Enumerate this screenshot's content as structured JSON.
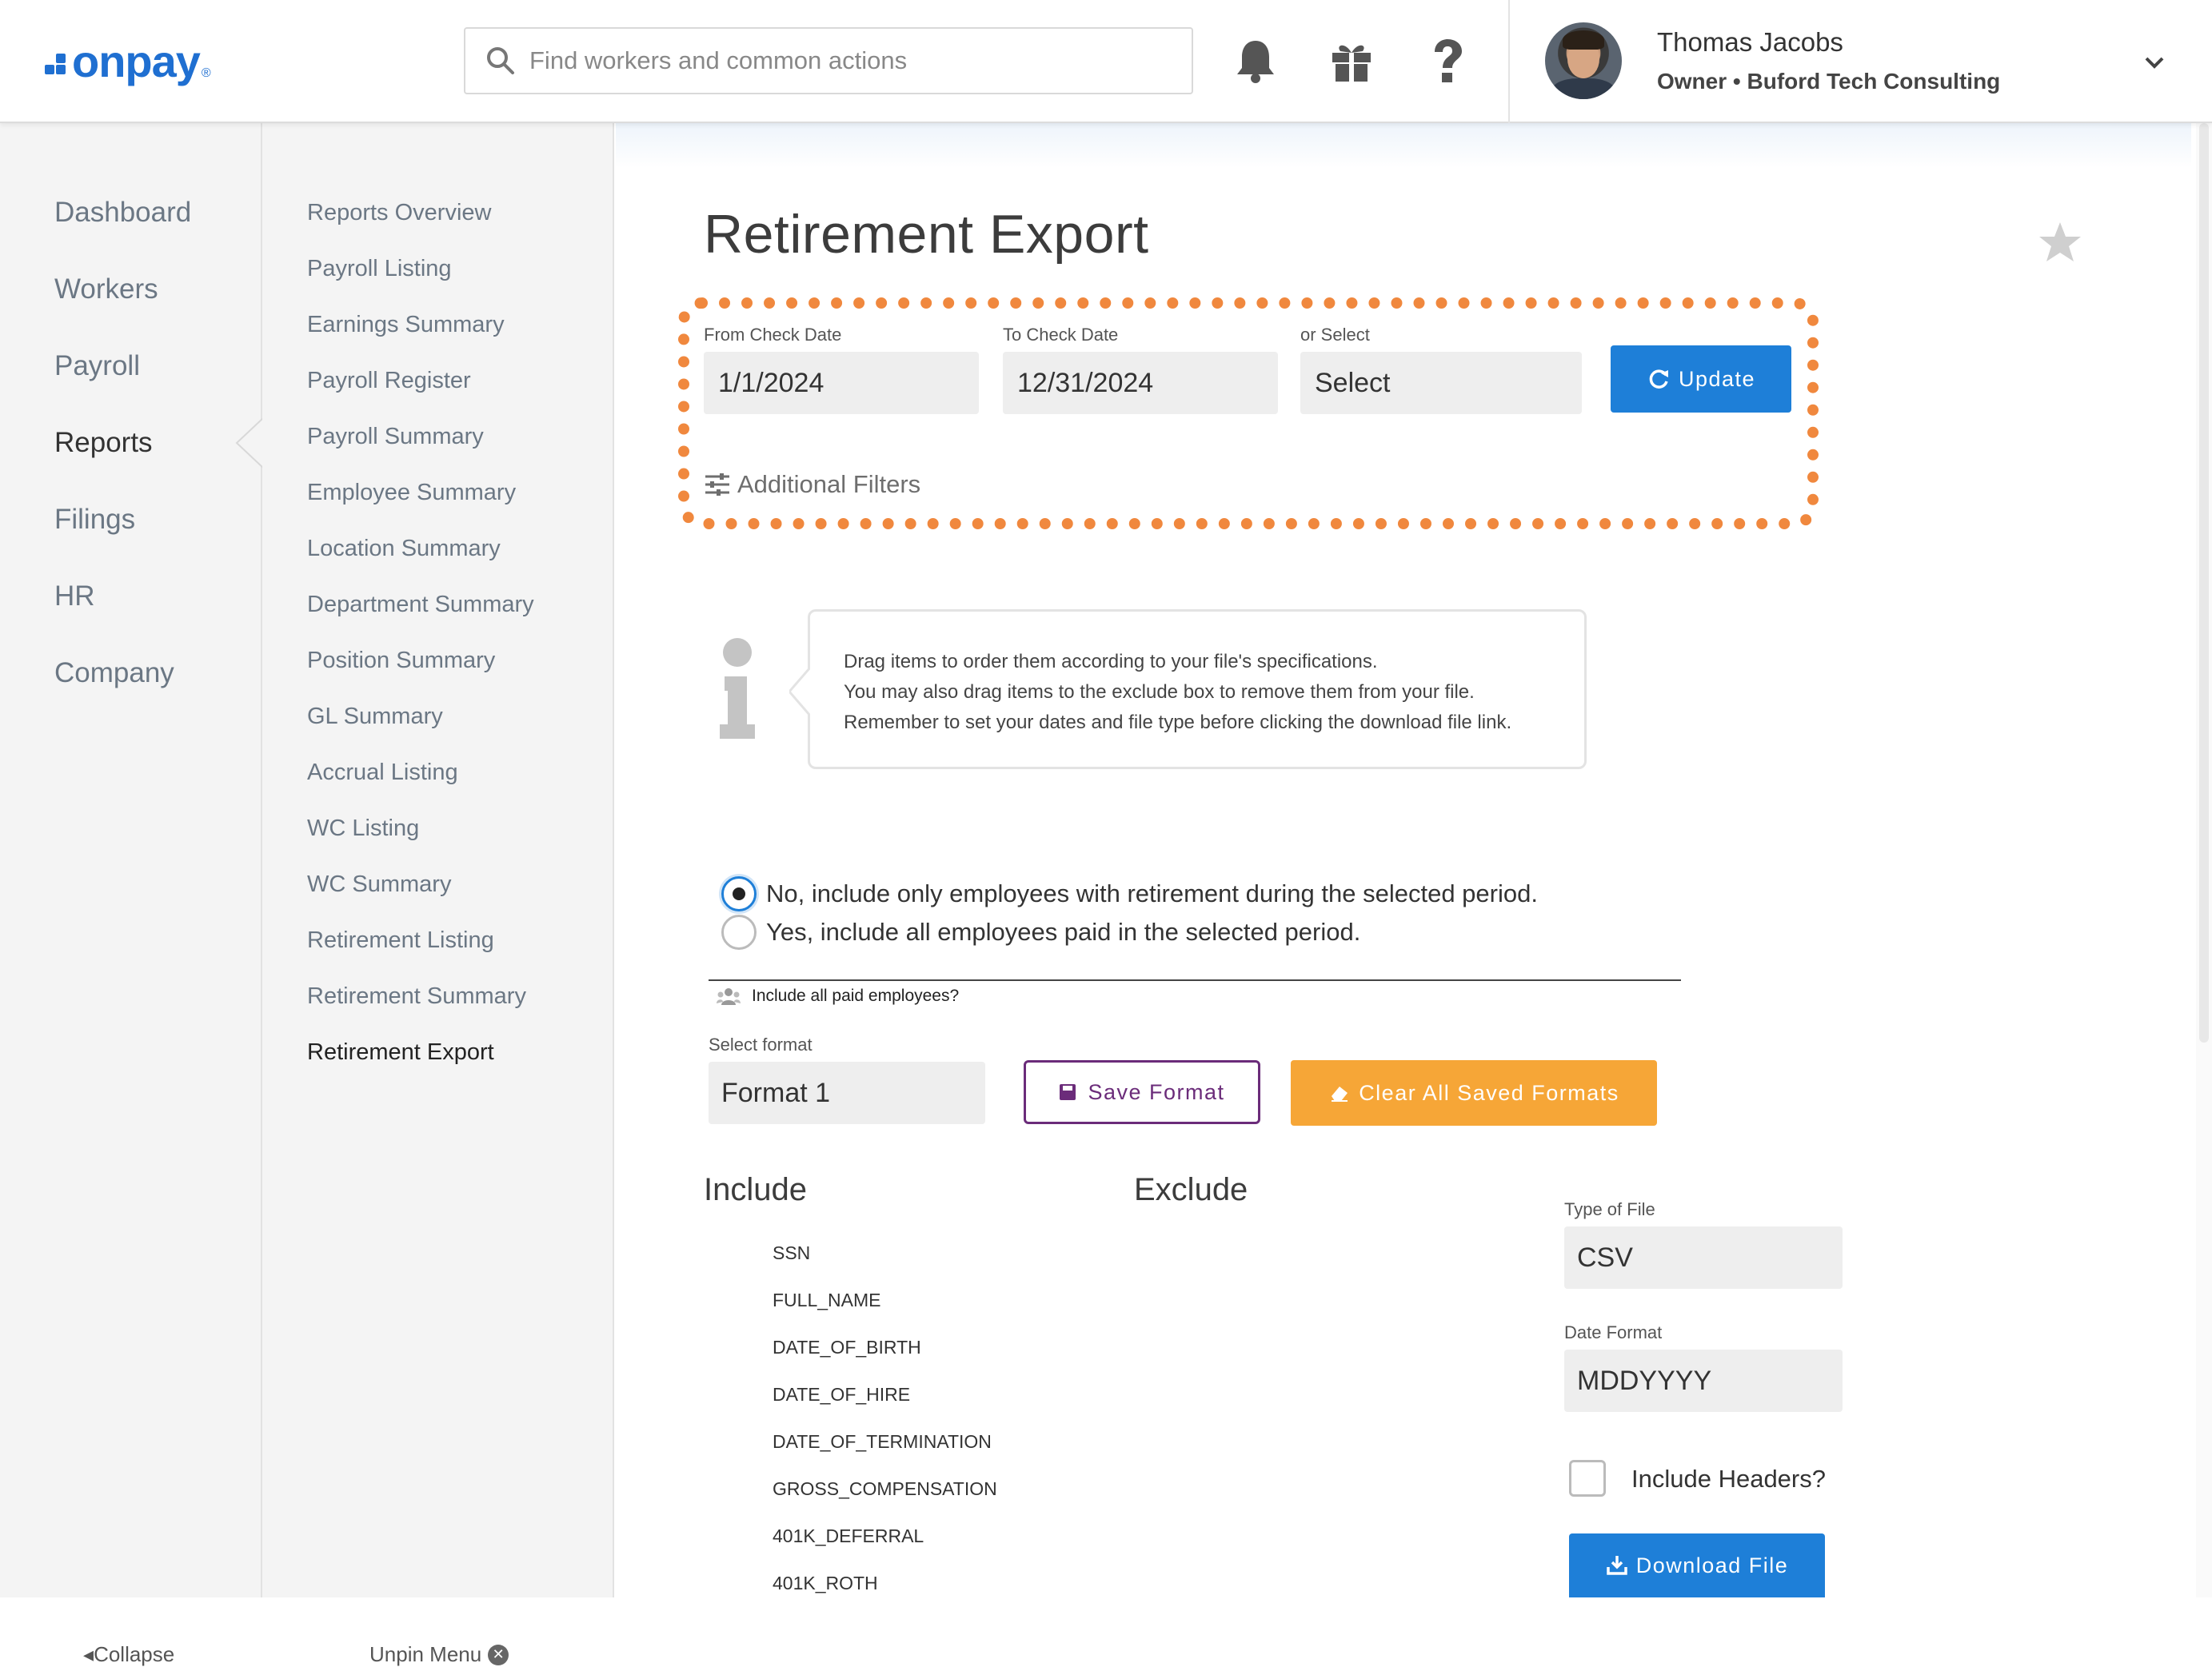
{
  "header": {
    "logo_text": "onpay",
    "logo_mark": "®",
    "search_placeholder": "Find workers and common actions",
    "icons": [
      "bell-icon",
      "gift-icon",
      "help-icon"
    ],
    "user": {
      "name": "Thomas Jacobs",
      "role": "Owner • Buford Tech Consulting"
    }
  },
  "leftnav": {
    "items": [
      "Dashboard",
      "Workers",
      "Payroll",
      "Reports",
      "Filings",
      "HR",
      "Company"
    ],
    "active": "Reports",
    "collapse_label": "Collapse"
  },
  "subnav": {
    "items": [
      "Reports Overview",
      "Payroll Listing",
      "Earnings Summary",
      "Payroll Register",
      "Payroll Summary",
      "Employee Summary",
      "Location Summary",
      "Department Summary",
      "Position Summary",
      "GL Summary",
      "Accrual Listing",
      "WC Listing",
      "WC Summary",
      "Retirement Listing",
      "Retirement Summary",
      "Retirement Export"
    ],
    "active": "Retirement Export",
    "unpin_label": "Unpin Menu"
  },
  "main": {
    "title": "Retirement Export",
    "filters": {
      "from_label": "From Check Date",
      "from_value": "1/1/2024",
      "to_label": "To Check Date",
      "to_value": "12/31/2024",
      "select_label": "or Select",
      "select_value": "Select",
      "update_label": "Update",
      "additional_label": "Additional Filters",
      "highlight_color": "#f0883e"
    },
    "info": {
      "line1": "Drag items to order them according to your file's specifications.",
      "line2": "You may also drag items to the exclude box to remove them from your file.",
      "line3": "Remember to set your dates and file type before clicking the download file link."
    },
    "radios": {
      "option_no": "No, include only employees with retirement during the selected period.",
      "option_yes": "Yes, include all employees paid in the selected period.",
      "selected": "no",
      "group_label": "Include all paid employees?"
    },
    "format": {
      "label": "Select format",
      "value": "Format 1",
      "save_label": "Save Format",
      "clear_label": "Clear All Saved Formats"
    },
    "include_heading": "Include",
    "exclude_heading": "Exclude",
    "include_fields": [
      "SSN",
      "FULL_NAME",
      "DATE_OF_BIRTH",
      "DATE_OF_HIRE",
      "DATE_OF_TERMINATION",
      "GROSS_COMPENSATION",
      "401K_DEFERRAL",
      "401K_ROTH"
    ],
    "exclude_fields": [],
    "file": {
      "type_label": "Type of File",
      "type_value": "CSV",
      "date_label": "Date Format",
      "date_value": "MDDYYYY",
      "headers_label": "Include Headers?",
      "headers_checked": false,
      "download_label": "Download File"
    }
  },
  "colors": {
    "brand_blue": "#1f6fd1",
    "button_blue": "#1e7fd8",
    "save_purple": "#6b2c7a",
    "clear_orange": "#f6a637"
  }
}
